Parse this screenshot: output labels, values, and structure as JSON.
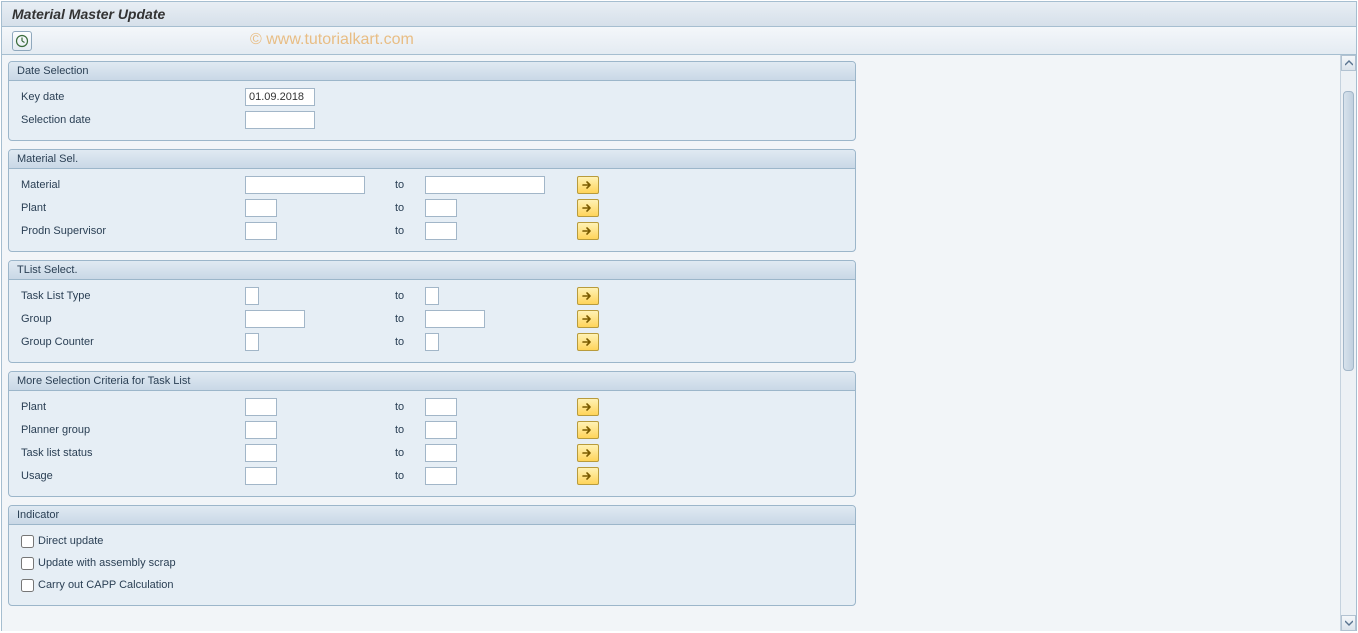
{
  "title": "Material Master Update",
  "watermark": "© www.tutorialkart.com",
  "toolbar": {
    "execute_icon": "execute"
  },
  "groups": {
    "date_selection": {
      "header": "Date Selection",
      "key_date_label": "Key date",
      "key_date_value": "01.09.2018",
      "selection_date_label": "Selection date",
      "selection_date_value": ""
    },
    "material_sel": {
      "header": "Material Sel.",
      "to_word": "to",
      "rows": [
        {
          "label": "Material",
          "from": "",
          "to_val": "",
          "from_w": "in-w1",
          "to_w": "in-w1"
        },
        {
          "label": "Plant",
          "from": "",
          "to_val": "",
          "from_w": "in-w2",
          "to_w": "in-w2"
        },
        {
          "label": "Prodn Supervisor",
          "from": "",
          "to_val": "",
          "from_w": "in-w2",
          "to_w": "in-w2"
        }
      ]
    },
    "tlist_select": {
      "header": "TList Select.",
      "to_word": "to",
      "rows": [
        {
          "label": "Task List Type",
          "from": "",
          "to_val": "",
          "from_w": "in-w3",
          "to_w": "in-w3"
        },
        {
          "label": "Group",
          "from": "",
          "to_val": "",
          "from_w": "in-w4",
          "to_w": "in-w4"
        },
        {
          "label": "Group Counter",
          "from": "",
          "to_val": "",
          "from_w": "in-w3",
          "to_w": "in-w3"
        }
      ]
    },
    "more_criteria": {
      "header": "More Selection Criteria for Task List",
      "to_word": "to",
      "rows": [
        {
          "label": "Plant",
          "from": "",
          "to_val": "",
          "from_w": "in-w2",
          "to_w": "in-w2"
        },
        {
          "label": "Planner group",
          "from": "",
          "to_val": "",
          "from_w": "in-w2",
          "to_w": "in-w2"
        },
        {
          "label": "Task list status",
          "from": "",
          "to_val": "",
          "from_w": "in-w2",
          "to_w": "in-w2"
        },
        {
          "label": "Usage",
          "from": "",
          "to_val": "",
          "from_w": "in-w2",
          "to_w": "in-w2"
        }
      ]
    },
    "indicator": {
      "header": "Indicator",
      "checks": [
        {
          "label": "Direct update",
          "checked": false
        },
        {
          "label": "Update with assembly scrap",
          "checked": false
        },
        {
          "label": "Carry out CAPP Calculation",
          "checked": false
        }
      ]
    }
  }
}
